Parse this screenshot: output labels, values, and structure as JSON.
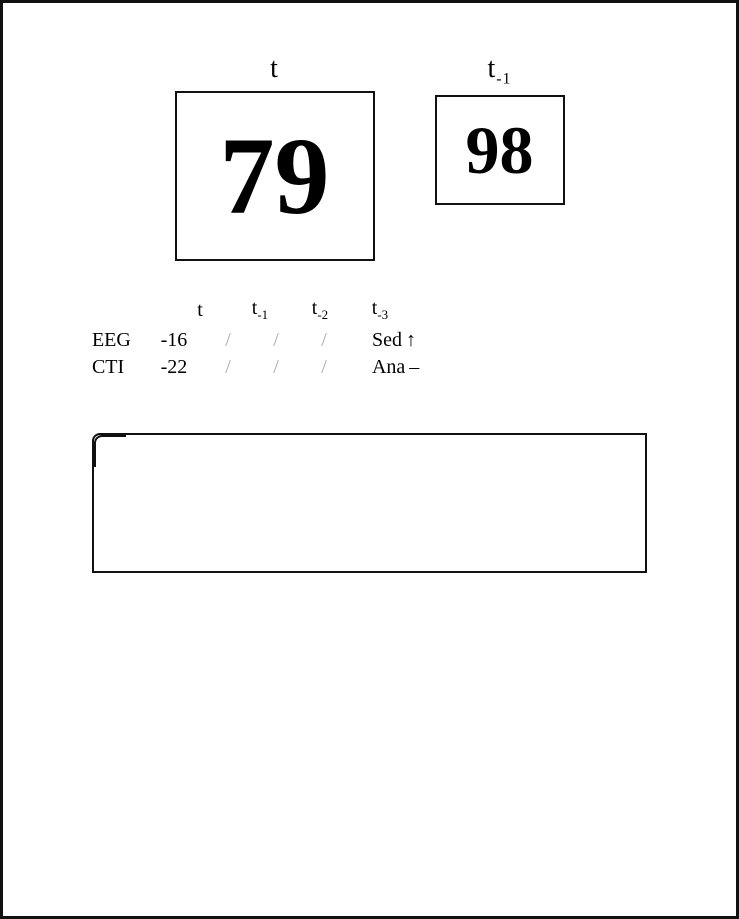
{
  "main": {
    "t_label": "t",
    "t_minus1_label": "t-1",
    "current_value": "79",
    "prev_value": "98",
    "col_headers": [
      "t",
      "t₋₁",
      "t₋₂",
      "t₋₃"
    ],
    "rows": [
      {
        "label": "EEG",
        "t_val": "-16",
        "slashes": [
          "/",
          "/",
          "/"
        ],
        "status_label": "Sed",
        "status_symbol": "↑"
      },
      {
        "label": "CTI",
        "t_val": "-22",
        "slashes": [
          "/",
          "/",
          "/"
        ],
        "status_label": "Ana",
        "status_symbol": "–"
      }
    ]
  }
}
